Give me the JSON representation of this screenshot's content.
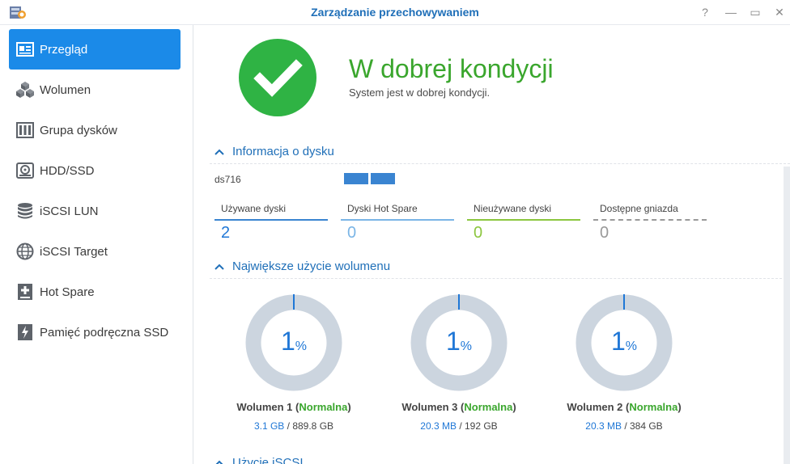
{
  "window": {
    "title": "Zarządzanie przechowywaniem",
    "buttons": [
      "?",
      "—",
      "▭",
      "✕"
    ]
  },
  "sidebar": {
    "items": [
      {
        "label": "Przegląd",
        "icon": "overview-icon",
        "active": true
      },
      {
        "label": "Wolumen",
        "icon": "cubes-icon"
      },
      {
        "label": "Grupa dysków",
        "icon": "disk-group-icon"
      },
      {
        "label": "HDD/SSD",
        "icon": "hdd-icon"
      },
      {
        "label": "iSCSI LUN",
        "icon": "database-icon"
      },
      {
        "label": "iSCSI Target",
        "icon": "globe-icon"
      },
      {
        "label": "Hot Spare",
        "icon": "hot-spare-icon"
      },
      {
        "label": "Pamięć podręczna SSD",
        "icon": "ssd-cache-icon"
      }
    ]
  },
  "status": {
    "title": "W dobrej kondycji",
    "subtitle": "System jest w dobrej kondycji.",
    "color": "#2fb344"
  },
  "disk_info": {
    "section_title": "Informacja o dysku",
    "device": "ds716",
    "stats": [
      {
        "label": "Używane dyski",
        "value": "2",
        "color": "#3a84d1"
      },
      {
        "label": "Dyski Hot Spare",
        "value": "0",
        "color": "#7ab5e6"
      },
      {
        "label": "Nieużywane dyski",
        "value": "0",
        "color": "#8cc63f"
      },
      {
        "label": "Dostępne gniazda",
        "value": "0",
        "color": "#999999"
      }
    ]
  },
  "volume_usage": {
    "section_title": "Największe użycie wolumenu",
    "volumes": [
      {
        "name": "Wolumen 1",
        "status": "Normalna",
        "percent": 1,
        "percent_unit": "%",
        "used": "3.1 GB",
        "total": "/ 889.8 GB"
      },
      {
        "name": "Wolumen 3",
        "status": "Normalna",
        "percent": 1,
        "percent_unit": "%",
        "used": "20.3 MB",
        "total": "/ 192 GB"
      },
      {
        "name": "Wolumen 2",
        "status": "Normalna",
        "percent": 1,
        "percent_unit": "%",
        "used": "20.3 MB",
        "total": "/ 384 GB"
      }
    ]
  },
  "iscsi": {
    "section_title": "Użycie iSCSI"
  }
}
